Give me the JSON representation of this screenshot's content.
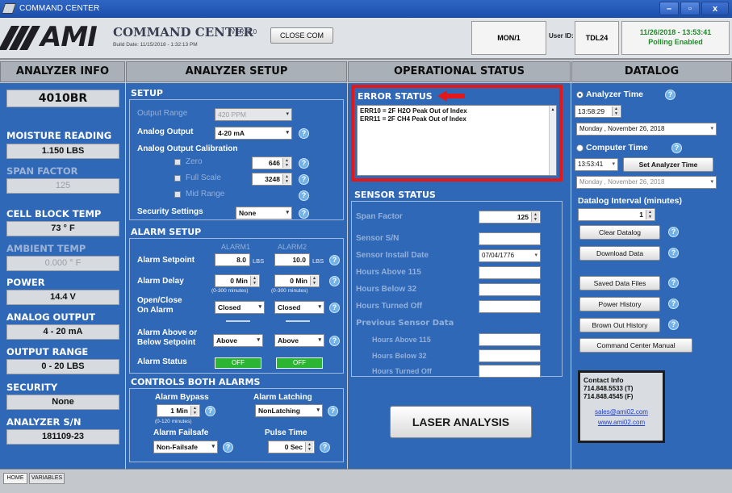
{
  "window": {
    "title": "COMMAND CENTER"
  },
  "header": {
    "logo_text": "AMI",
    "app_title": "COMMAND CENTER",
    "version": "VER. 8.0",
    "build_date": "Build Date: 11/15/2018 - 1:32:13 PM",
    "close_com_label": "CLOSE COM",
    "mon_value": "MON/1",
    "user_id_label": "User ID:",
    "user_id_value": "TDL24",
    "datetime": "11/26/2018 - 13:53:41",
    "polling_status": "Polling Enabled"
  },
  "section_headers": {
    "analyzer_info": "ANALYZER INFO",
    "analyzer_setup": "ANALYZER SETUP",
    "operational_status": "OPERATIONAL STATUS",
    "datalog": "DATALOG"
  },
  "analyzer_info": {
    "model": "4010BR",
    "moisture_label": "MOISTURE READING",
    "moisture_value": "1.150 LBS",
    "span_label": "SPAN FACTOR",
    "span_value": "125",
    "cell_temp_label": "CELL BLOCK TEMP",
    "cell_temp_value": "73 ° F",
    "ambient_label": "AMBIENT TEMP",
    "ambient_value": "0.000 ° F",
    "power_label": "POWER",
    "power_value": "14.4 V",
    "analog_output_label": "ANALOG OUTPUT",
    "analog_output_value": "4 - 20 mA",
    "output_range_label": "OUTPUT RANGE",
    "output_range_value": "0 - 20 LBS",
    "security_label": "SECURITY",
    "security_value": "None",
    "serial_label": "ANALYZER S/N",
    "serial_value": "181109-23"
  },
  "setup": {
    "title": "SETUP",
    "output_range_label": "Output Range",
    "output_range_value": "420 PPM",
    "analog_output_label": "Analog Output",
    "analog_output_value": "4-20 mA",
    "calibration_label": "Analog Output Calibration",
    "zero_label": "Zero",
    "zero_value": "646",
    "full_scale_label": "Full Scale",
    "full_scale_value": "3248",
    "mid_range_label": "Mid Range",
    "security_label": "Security Settings",
    "security_value": "None"
  },
  "alarm_setup": {
    "title": "ALARM SETUP",
    "alarm1_label": "ALARM1",
    "alarm2_label": "ALARM2",
    "setpoint_label": "Alarm Setpoint",
    "setpoint1": "8.0",
    "setpoint2": "10.0",
    "unit": "LBS",
    "delay_label": "Alarm Delay",
    "delay1": "0 Min",
    "delay2": "0 Min",
    "delay_hint": "(0-300 minutes)",
    "open_close_label_1": "Open/Close",
    "open_close_label_2": "On Alarm",
    "open_close1": "Closed",
    "open_close2": "Closed",
    "above_below_label_1": "Alarm Above or",
    "above_below_label_2": "Below Setpoint",
    "above_below1": "Above",
    "above_below2": "Above",
    "status_label": "Alarm Status",
    "status1": "OFF",
    "status2": "OFF"
  },
  "controls": {
    "title": "CONTROLS BOTH ALARMS",
    "bypass_label": "Alarm Bypass",
    "bypass_value": "1 Min",
    "bypass_hint": "(0-120 minutes)",
    "latching_label": "Alarm Latching",
    "latching_value": "NonLatching",
    "failsafe_label": "Alarm Failsafe",
    "failsafe_value": "Non-Failsafe",
    "pulse_label": "Pulse Time",
    "pulse_value": "0 Sec"
  },
  "error_status": {
    "title": "ERROR STATUS",
    "errors": [
      "ERR10 = 2F H2O Peak Out of Index",
      "ERR11 = 2F CH4 Peak Out of Index"
    ]
  },
  "sensor_status": {
    "title": "SENSOR STATUS",
    "span_label": "Span Factor",
    "span_value": "125",
    "sn_label": "Sensor S/N",
    "install_label": "Sensor Install Date",
    "install_value": "07/04/1776",
    "above_label": "Hours Above 115",
    "below_label": "Hours Below 32",
    "turned_off_label": "Hours Turned Off",
    "prev_title": "Previous Sensor Data",
    "prev_above_label": "Hours Above 115",
    "prev_below_label": "Hours Below 32",
    "prev_off_label": "Hours Turned Off",
    "laser_button": "LASER ANALYSIS"
  },
  "datalog": {
    "analyzer_time_label": "Analyzer Time",
    "analyzer_time": "13:58:29",
    "analyzer_date": "Monday   , November 26, 2018",
    "computer_time_label": "Computer Time",
    "computer_time": "13:53:41",
    "set_time_button": "Set Analyzer Time",
    "computer_date": "Monday   , November 26, 2018",
    "interval_label": "Datalog Interval (minutes)",
    "interval_value": "1",
    "buttons": {
      "clear": "Clear Datalog",
      "download": "Download Data",
      "saved": "Saved Data Files",
      "power": "Power History",
      "brownout": "Brown Out History",
      "manual": "Command Center Manual"
    },
    "contact_title": "Contact Info",
    "phone1": "714.848.5533 (T)",
    "phone2": "714.848.4545 (F)",
    "email": "sales@ami02.com",
    "website": "www.ami02.com"
  },
  "tabs": {
    "home": "HOME",
    "variables": "VARIABLES"
  },
  "colors": {
    "panel_blue": "#2f68b6",
    "error_highlight": "#e31919",
    "status_green": "#2bb533",
    "polling_green": "#1f8a2a"
  },
  "icons": [
    "app-icon",
    "help-icon",
    "arrow-left-icon",
    "spin-icon",
    "dropdown-arrow-icon"
  ]
}
